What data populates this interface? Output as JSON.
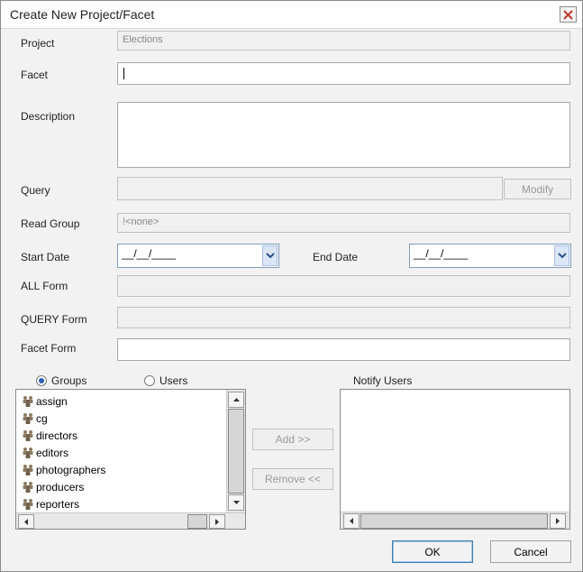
{
  "dialog": {
    "title": "Create New Project/Facet"
  },
  "form": {
    "project_label": "Project",
    "project_value": "Elections",
    "facet_label": "Facet",
    "facet_value": "",
    "description_label": "Description",
    "description_value": "",
    "query_label": "Query",
    "query_value": "",
    "modify_label": "Modify",
    "read_group_label": "Read Group",
    "read_group_value": "!<none>",
    "start_date_label": "Start Date",
    "start_date_value": "__/__/____",
    "end_date_label": "End Date",
    "end_date_value": "__/__/____",
    "all_form_label": "ALL Form",
    "all_form_value": "",
    "query_form_label": "QUERY Form",
    "query_form_value": "",
    "facet_form_label": "Facet Form",
    "facet_form_value": ""
  },
  "selector": {
    "groups_label": "Groups",
    "users_label": "Users",
    "selected": "Groups",
    "items": [
      "assign",
      "cg",
      "directors",
      "editors",
      "photographers",
      "producers",
      "reporters"
    ],
    "add_label": "Add >>",
    "remove_label": "Remove <<"
  },
  "notify": {
    "label": "Notify Users",
    "items": []
  },
  "footer": {
    "ok_label": "OK",
    "cancel_label": "Cancel"
  },
  "colors": {
    "accent": "#2b5fb3",
    "group_icon": "#8c7a62"
  }
}
